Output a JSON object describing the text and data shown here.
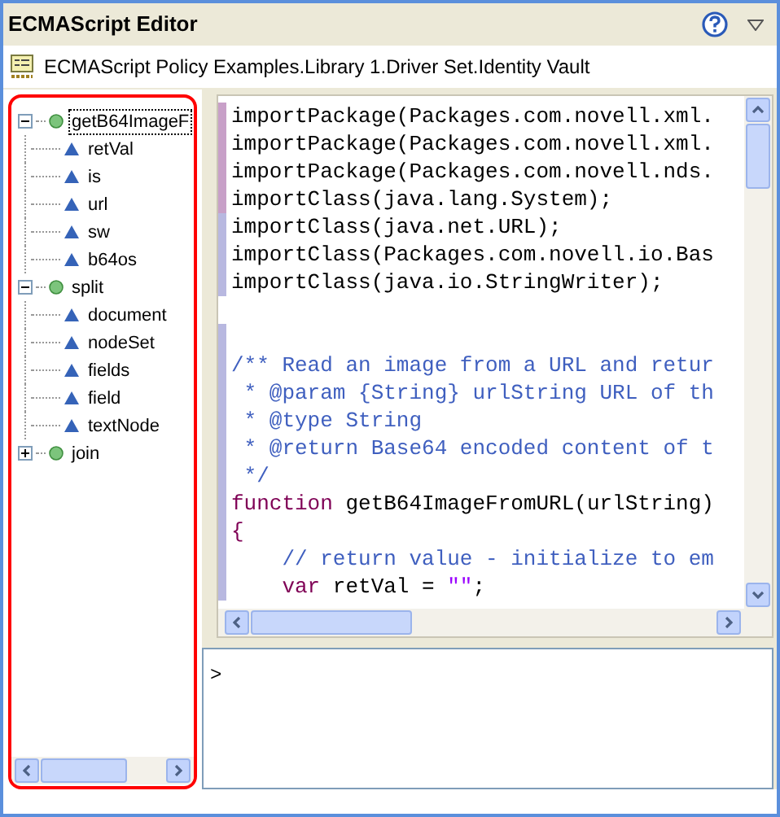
{
  "window": {
    "title": "ECMAScript Editor"
  },
  "path": "ECMAScript Policy Examples.Library 1.Driver Set.Identity Vault",
  "tree": [
    {
      "kind": "function",
      "label": "getB64ImageF",
      "selected": true,
      "expanded": true,
      "children": [
        {
          "kind": "variable",
          "label": "retVal",
          "selected": false
        },
        {
          "kind": "variable",
          "label": "is",
          "selected": false
        },
        {
          "kind": "variable",
          "label": "url",
          "selected": false
        },
        {
          "kind": "variable",
          "label": "sw",
          "selected": false
        },
        {
          "kind": "variable",
          "label": "b64os",
          "selected": false
        }
      ]
    },
    {
      "kind": "function",
      "label": "split",
      "selected": false,
      "expanded": true,
      "children": [
        {
          "kind": "variable",
          "label": "document",
          "selected": false
        },
        {
          "kind": "variable",
          "label": "nodeSet",
          "selected": false
        },
        {
          "kind": "variable",
          "label": "fields",
          "selected": false
        },
        {
          "kind": "variable",
          "label": "field",
          "selected": false
        },
        {
          "kind": "variable",
          "label": "textNode",
          "selected": false
        }
      ]
    },
    {
      "kind": "function",
      "label": "join",
      "selected": false,
      "expanded": false
    }
  ],
  "editor": {
    "lines": [
      {
        "kind": "code",
        "color": "#c8a0c8",
        "segments": [
          {
            "kind": "plain",
            "text": "importPackage(Packages.com.novell.xml."
          }
        ]
      },
      {
        "kind": "code",
        "color": "#c8a0c8",
        "segments": [
          {
            "kind": "plain",
            "text": "importPackage(Packages.com.novell.xml."
          }
        ]
      },
      {
        "kind": "code",
        "color": "#c8a0c8",
        "segments": [
          {
            "kind": "plain",
            "text": "importPackage(Packages.com.novell.nds."
          }
        ]
      },
      {
        "kind": "code",
        "color": "#c8a0c8",
        "segments": [
          {
            "kind": "plain",
            "text": "importClass(java.lang.System);"
          }
        ]
      },
      {
        "kind": "code",
        "color": "#b8b8e0",
        "segments": [
          {
            "kind": "plain",
            "text": "importClass(java.net.URL);"
          }
        ]
      },
      {
        "kind": "code",
        "color": "#b8b8e0",
        "segments": [
          {
            "kind": "plain",
            "text": "importClass(Packages.com.novell.io.Bas"
          }
        ]
      },
      {
        "kind": "code",
        "color": "#b8b8e0",
        "segments": [
          {
            "kind": "plain",
            "text": "importClass(java.io.StringWriter);"
          }
        ]
      },
      {
        "kind": "blank"
      },
      {
        "kind": "code",
        "color": "#b8b8e0"
      },
      {
        "kind": "code",
        "color": "#b8b8e0",
        "segments": [
          {
            "kind": "comment",
            "text": "/** Read an image from a URL and retur"
          }
        ]
      },
      {
        "kind": "code",
        "color": "#b8b8e0",
        "segments": [
          {
            "kind": "comment",
            "text": " * @param {String} urlString URL of th"
          }
        ]
      },
      {
        "kind": "code",
        "color": "#b8b8e0",
        "segments": [
          {
            "kind": "comment",
            "text": " * @type String"
          }
        ]
      },
      {
        "kind": "code",
        "color": "#b8b8e0",
        "segments": [
          {
            "kind": "comment",
            "text": " * @return Base64 encoded content of t"
          }
        ]
      },
      {
        "kind": "code",
        "color": "#b8b8e0",
        "segments": [
          {
            "kind": "comment",
            "text": " */"
          }
        ]
      },
      {
        "kind": "code",
        "color": "#b8b8e0",
        "segments": [
          {
            "kind": "keyword",
            "text": "function"
          },
          {
            "kind": "plain",
            "text": " getB64ImageFromURL(urlString)"
          }
        ]
      },
      {
        "kind": "code",
        "color": "#b8b8e0",
        "segments": [
          {
            "kind": "keyword",
            "text": "{"
          }
        ]
      },
      {
        "kind": "code",
        "color": "#b8b8e0",
        "segments": [
          {
            "kind": "comment",
            "text": "    // return value - initialize to em"
          }
        ]
      },
      {
        "kind": "code",
        "color": "#b8b8e0",
        "segments": [
          {
            "kind": "keyword",
            "text": "    var"
          },
          {
            "kind": "plain",
            "text": " retVal = "
          },
          {
            "kind": "string",
            "text": "\"\""
          },
          {
            "kind": "plain",
            "text": ";"
          }
        ]
      }
    ]
  },
  "console": {
    "prompt": ">"
  }
}
